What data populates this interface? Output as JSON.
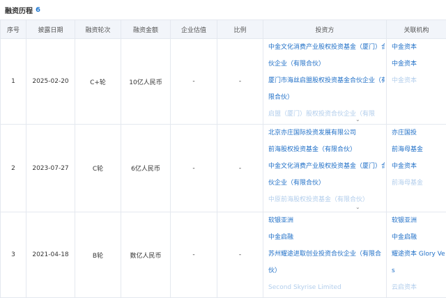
{
  "section": {
    "title": "融资历程",
    "count": "6"
  },
  "columns": [
    "序号",
    "披露日期",
    "融资轮次",
    "融资金额",
    "企业估值",
    "比例",
    "投资方",
    "关联机构"
  ],
  "rows": [
    {
      "index": "1",
      "date": "2025-02-20",
      "round": "C+轮",
      "amount": "10亿人民币",
      "valuation": "-",
      "ratio": "-",
      "investor_lines": [
        "中金文化消费产业股权投资基金（厦门）合",
        "伙企业（有限合伙）",
        "厦门市海丝启盟股权投资基金合伙企业（有",
        "限合伙）",
        "启盟（厦门）股权投资合伙企业（有限"
      ],
      "related_lines": [
        "中金资本",
        "",
        "中金资本",
        "",
        "中金资本"
      ]
    },
    {
      "index": "2",
      "date": "2023-07-27",
      "round": "C轮",
      "amount": "6亿人民币",
      "valuation": "-",
      "ratio": "-",
      "investor_lines": [
        "北京亦庄国际投资发展有限公司",
        "前海股权投资基金（有限合伙）",
        "中金文化消费产业股权投资基金（厦门）合",
        "伙企业（有限合伙）",
        "中原前海股权投资基金（有限合伙）"
      ],
      "related_lines": [
        "亦庄国投",
        "前海母基金",
        "中金资本",
        "",
        "前海母基金"
      ]
    },
    {
      "index": "3",
      "date": "2021-04-18",
      "round": "B轮",
      "amount": "数亿人民币",
      "valuation": "-",
      "ratio": "-",
      "investor_lines": [
        "软银亚洲",
        "中金启融",
        "苏州耀途进取创业投资合伙企业（有限合",
        "伙）",
        "Second Skyrise Limited"
      ],
      "related_lines": [
        "软银亚洲",
        "中金启融",
        "耀途资本 Glory Venture",
        "s",
        "云启资本"
      ]
    }
  ],
  "expand_icon": "chevron-down-icon",
  "colors": {
    "accent": "#1f78d1",
    "link": "#1f6fc7",
    "header_bg": "#f2f5fa",
    "border": "#e4e8ef"
  }
}
